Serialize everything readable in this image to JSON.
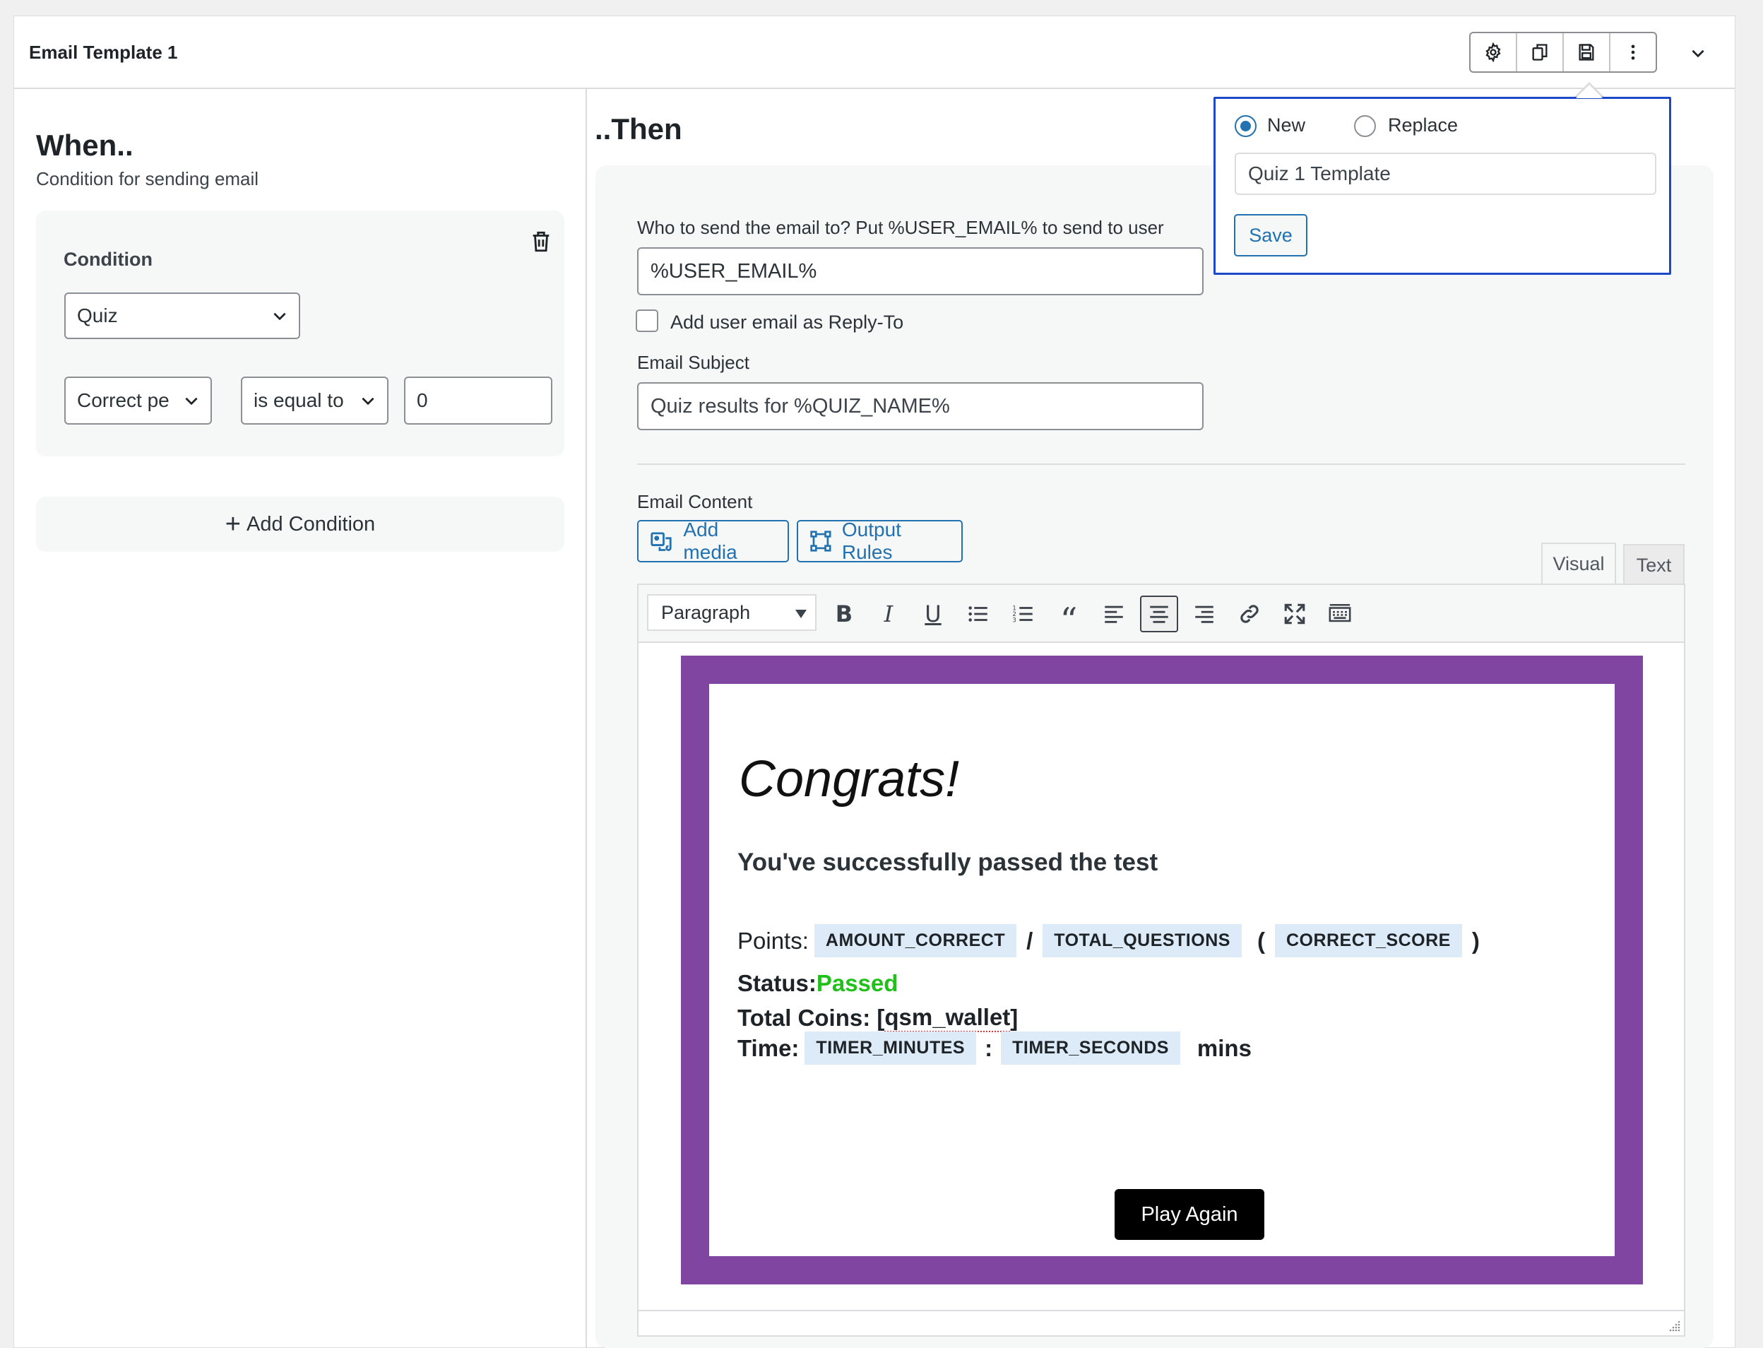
{
  "panel": {
    "title": "Email Template 1",
    "toolbar_icons": [
      "gear-icon",
      "duplicate-icon",
      "save-icon",
      "more-vertical-icon"
    ],
    "collapse_icon": "chevron-down-icon"
  },
  "when": {
    "heading": "When..",
    "subheading": "Condition for sending email",
    "condition_label": "Condition",
    "type_select": "Quiz",
    "field_select": "Correct pe",
    "operator_select": "is equal to",
    "value": "0",
    "add_condition_label": "Add Condition"
  },
  "then": {
    "heading": "..Then",
    "to_label": "Who to send the email to? Put %USER_EMAIL% to send to user",
    "to_value": "%USER_EMAIL%",
    "reply_to_label": "Add user email as Reply-To",
    "subject_label": "Email Subject",
    "subject_value": "Quiz results for %QUIZ_NAME%",
    "content_label": "Email Content",
    "add_media_label": "Add media",
    "output_rules_label": "Output Rules",
    "tab_visual": "Visual",
    "tab_text": "Text",
    "paragraph_select": "Paragraph"
  },
  "email": {
    "frame_color": "#7f45a1",
    "heading": "Congrats!",
    "subheading": "You've successfully passed the test",
    "points_label": "Points:",
    "tag_amount_correct": "AMOUNT_CORRECT",
    "slash": "/",
    "tag_total_questions": "TOTAL_QUESTIONS",
    "paren_open": "(",
    "tag_correct_score": "CORRECT_SCORE",
    "paren_close": ")",
    "status_label": "Status:",
    "status_value": "Passed",
    "status_color": "#22c01a",
    "coins_label": "Total Coins: [",
    "coins_shortcode": "qsm_wallet",
    "coins_close": "]",
    "time_label": "Time:",
    "tag_timer_minutes": "TIMER_MINUTES",
    "colon": ":",
    "tag_timer_seconds": "TIMER_SECONDS",
    "time_unit": "mins",
    "play_again": "Play Again"
  },
  "popover": {
    "radio_new": "New",
    "radio_replace": "Replace",
    "selected": "New",
    "template_name": "Quiz 1 Template",
    "save_label": "Save"
  }
}
